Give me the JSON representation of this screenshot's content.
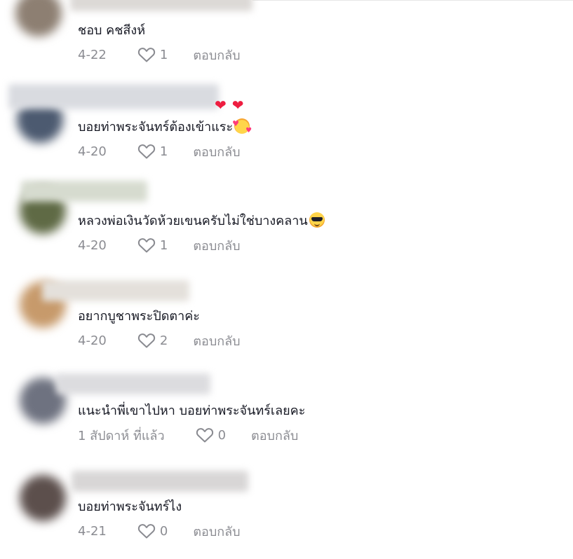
{
  "comments": [
    {
      "text": "ชอบ คชสีงห์",
      "emoji": "",
      "date": "4-22",
      "likes": "1",
      "reply_label": "ตอบกลับ",
      "avatar_color": "#8d7f72",
      "name_blur_color": "#dcd9d6"
    },
    {
      "text": "บอยท่าพระจันทร์ต้องเข้าแระ",
      "emoji": "smiling-face-with-hearts",
      "hearts": "❤❤",
      "date": "4-20",
      "likes": "1",
      "reply_label": "ตอบกลับ",
      "avatar_color": "#4c5a70",
      "name_blur_color": "#d9dbe0"
    },
    {
      "text": "หลวงพ่อเงินวัดห้วยเขนครับไม่ใช่บางคลาน",
      "emoji": "smiling-face-with-sunglasses",
      "date": "4-20",
      "likes": "1",
      "reply_label": "ตอบกลับ",
      "avatar_color": "#5f6a45",
      "name_blur_color": "#d6dbcf"
    },
    {
      "text": "อยากบูชาพระปิดตาค่ะ",
      "emoji": "",
      "date": "4-20",
      "likes": "2",
      "reply_label": "ตอบกลับ",
      "avatar_color": "#c79a6b",
      "name_blur_color": "#e4e0db"
    },
    {
      "text": "แนะนำพี่เขาไปหา บอยท่าพระจันทร์เลยคะ",
      "emoji": "",
      "date": "1 สัปดาห์ ที่แล้ว",
      "likes": "0",
      "reply_label": "ตอบกลับ",
      "avatar_color": "#6e7280",
      "name_blur_color": "#dcdcdf"
    },
    {
      "text": "บอยท่าพระจันทร์ไง",
      "emoji": "",
      "date": "4-21",
      "likes": "0",
      "reply_label": "ตอบกลับ",
      "avatar_color": "#5c4f4c",
      "name_blur_color": "#d8d6d6"
    }
  ],
  "colors": {
    "text": "#161823",
    "meta": "#8a8b91",
    "heart_emoji": "#ee1d40"
  },
  "icons": {
    "like": "heart-outline-icon"
  }
}
